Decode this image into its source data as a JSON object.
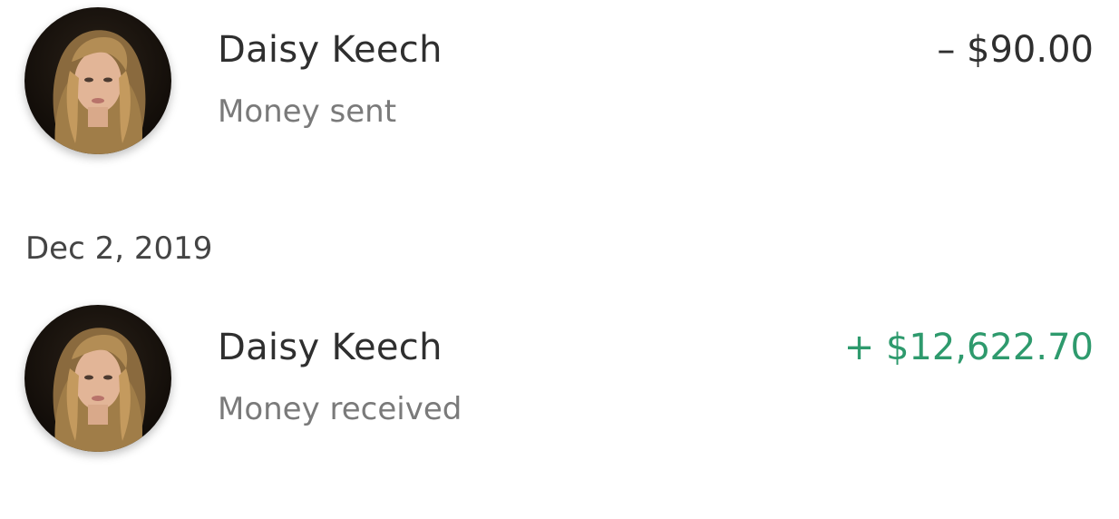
{
  "transactions": [
    {
      "name": "Daisy Keech",
      "subtitle": "Money sent",
      "amount": "– $90.00",
      "direction": "sent",
      "amount_color": "#2f2f2f",
      "avatar_icon": "avatar-photo"
    },
    {
      "name": "Daisy Keech",
      "subtitle": "Money received",
      "amount": "+ $12,622.70",
      "direction": "received",
      "amount_color": "#2e9a6d",
      "avatar_icon": "avatar-photo"
    }
  ],
  "date_header": "Dec 2, 2019",
  "colors": {
    "primary_text": "#2f2f2f",
    "secondary_text": "#7a7a7a",
    "positive_amount": "#2e9a6d",
    "background": "#ffffff"
  }
}
